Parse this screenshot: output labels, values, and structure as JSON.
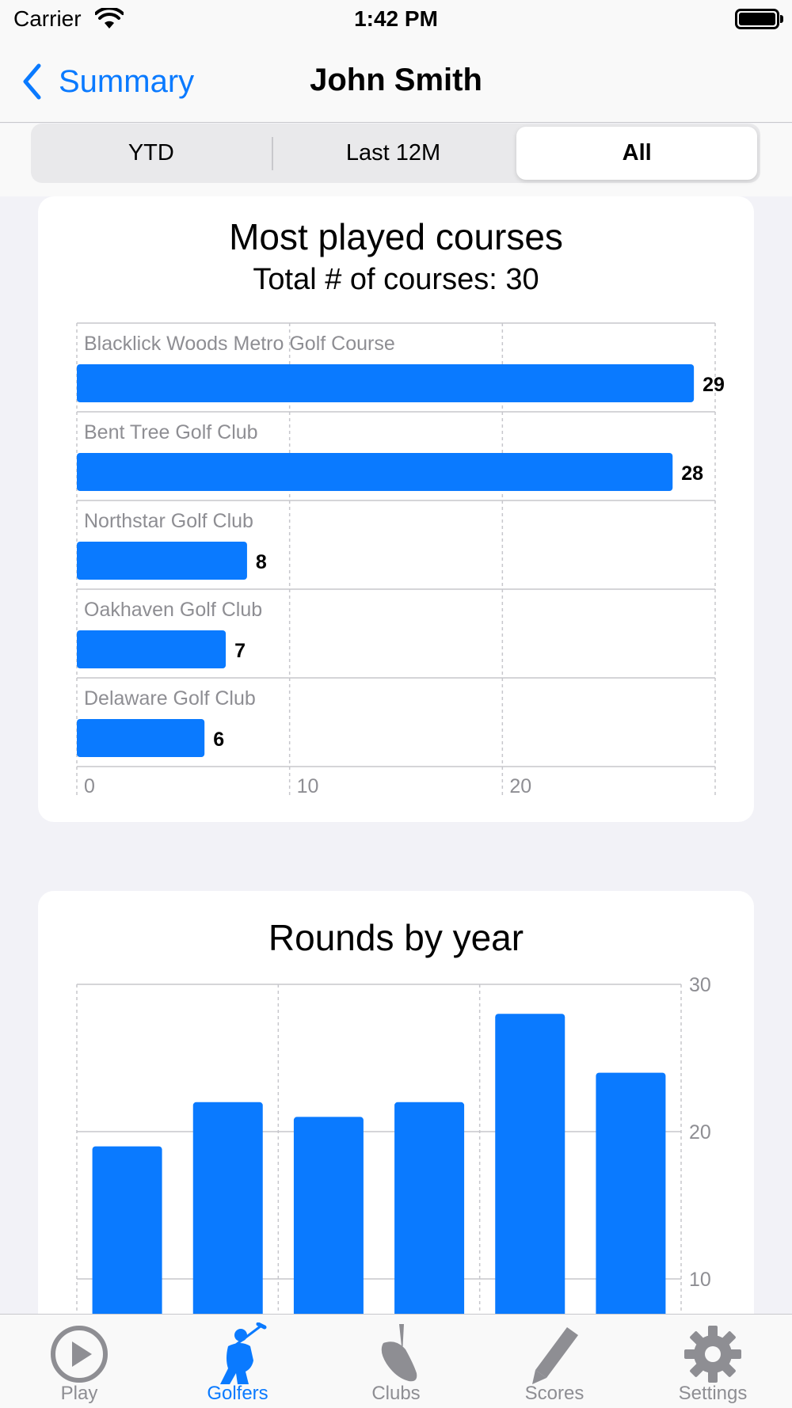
{
  "status_bar": {
    "carrier": "Carrier",
    "time": "1:42 PM"
  },
  "nav": {
    "back_label": "Summary",
    "title": "John Smith"
  },
  "segments": [
    {
      "label": "YTD",
      "selected": false
    },
    {
      "label": "Last 12M",
      "selected": false
    },
    {
      "label": "All",
      "selected": true
    }
  ],
  "courses_card": {
    "title": "Most played courses",
    "subtitle": "Total # of courses: 30"
  },
  "rounds_card": {
    "title": "Rounds by year"
  },
  "chart_data": [
    {
      "type": "bar",
      "orientation": "horizontal",
      "title": "Most played courses",
      "subtitle": "Total # of courses: 30",
      "categories": [
        "Blacklick Woods Metro Golf Course",
        "Bent Tree Golf Club",
        "Northstar Golf Club",
        "Oakhaven Golf Club",
        "Delaware Golf Club"
      ],
      "values": [
        29,
        28,
        8,
        7,
        6
      ],
      "xlim": [
        0,
        30
      ],
      "x_ticks": [
        0,
        10,
        20
      ],
      "bar_color": "#0a7aff",
      "grid": true
    },
    {
      "type": "bar",
      "orientation": "vertical",
      "title": "Rounds by year",
      "values": [
        19,
        22,
        21,
        22,
        28,
        24
      ],
      "ylim": [
        0,
        30
      ],
      "y_ticks": [
        10,
        20,
        30
      ],
      "y_axis_side": "right",
      "bar_color": "#0a7aff",
      "grid": true
    }
  ],
  "tabs": [
    {
      "label": "Play",
      "icon": "play-icon",
      "active": false
    },
    {
      "label": "Golfers",
      "icon": "golfer-icon",
      "active": true
    },
    {
      "label": "Clubs",
      "icon": "wedge-club-icon",
      "active": false
    },
    {
      "label": "Scores",
      "icon": "pencil-icon",
      "active": false
    },
    {
      "label": "Settings",
      "icon": "gear-icon",
      "active": false
    }
  ],
  "colors": {
    "accent": "#0a7aff",
    "inactive": "#8e8e93",
    "background": "#f2f2f7"
  }
}
